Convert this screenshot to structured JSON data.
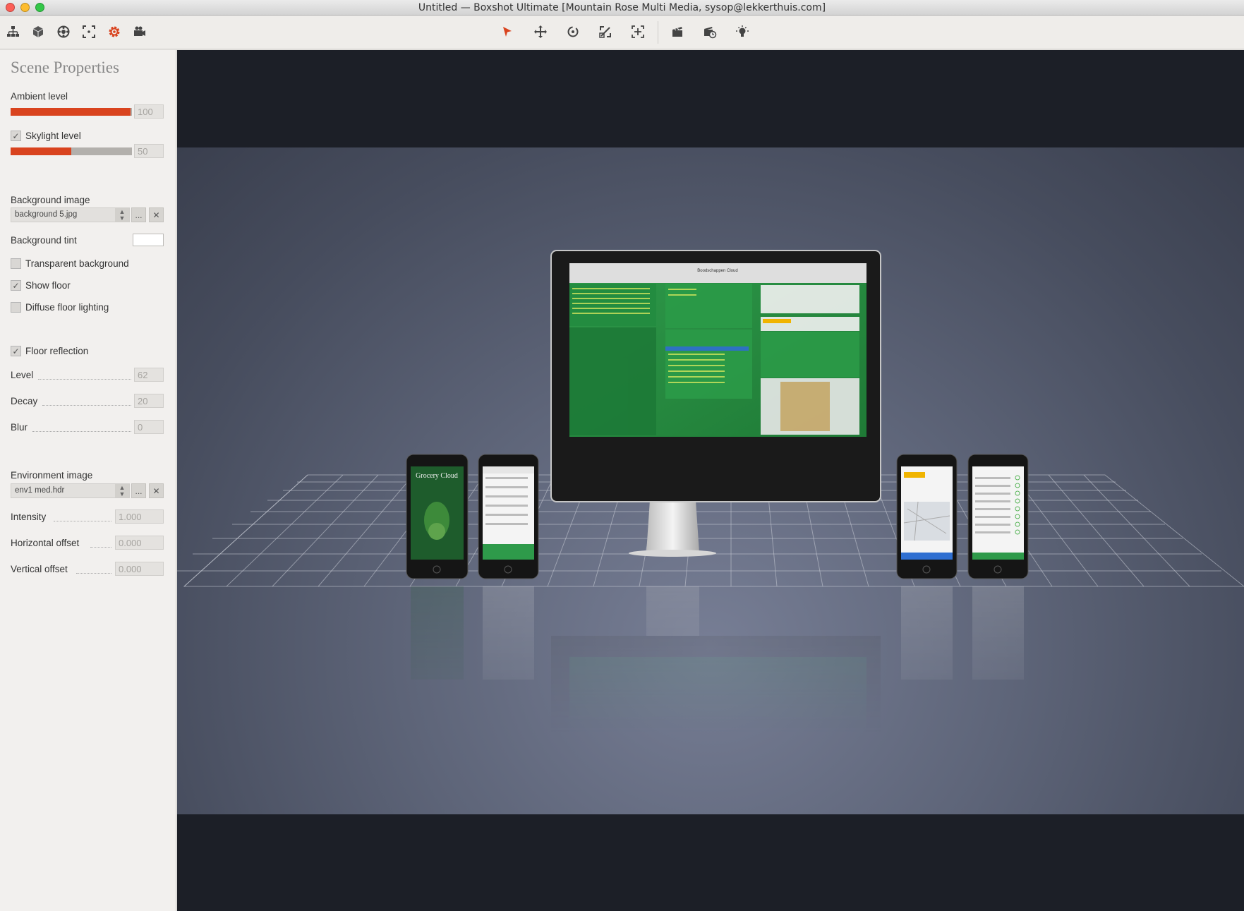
{
  "window": {
    "title": "Untitled — Boxshot Ultimate [Mountain Rose Multi Media, sysop@lekkerthuis.com]"
  },
  "toolbar": {
    "left_icons": [
      "scene-tree-icon",
      "cube-icon",
      "materials-icon",
      "camera-frame-icon",
      "settings-gear-icon",
      "video-camera-icon"
    ],
    "center_icons": [
      "select-arrow-icon",
      "move-icon",
      "rotate-icon",
      "scale-icon",
      "frame-fit-icon",
      "clapper-icon",
      "render-time-icon",
      "light-bulb-icon"
    ],
    "active": "settings-gear-icon",
    "accent_color": "#d9431e"
  },
  "panel": {
    "title": "Scene Properties",
    "ambient": {
      "label": "Ambient level",
      "value": "100",
      "level": 1.0
    },
    "skylight": {
      "label": "Skylight level",
      "checked": true,
      "value": "50",
      "level": 0.5
    },
    "background_image": {
      "label": "Background image",
      "value": "background 5.jpg",
      "browse": "...",
      "clear": "✕"
    },
    "background_tint": {
      "label": "Background tint",
      "color": "#ffffff"
    },
    "transparent_background": {
      "label": "Transparent background",
      "checked": false
    },
    "show_floor": {
      "label": "Show floor",
      "checked": true
    },
    "diffuse_floor_lighting": {
      "label": "Diffuse floor lighting",
      "checked": false
    },
    "floor_reflection": {
      "label": "Floor reflection",
      "checked": true
    },
    "level": {
      "label": "Level",
      "value": "62"
    },
    "decay": {
      "label": "Decay",
      "value": "20"
    },
    "blur": {
      "label": "Blur",
      "value": "0"
    },
    "environment_image": {
      "label": "Environment image",
      "value": "env1 med.hdr",
      "browse": "...",
      "clear": "✕"
    },
    "intensity": {
      "label": "Intensity",
      "value": "1.000"
    },
    "horizontal_offset": {
      "label": "Horizontal offset",
      "value": "0.000"
    },
    "vertical_offset": {
      "label": "Vertical offset",
      "value": "0.000"
    }
  },
  "scene": {
    "monitor_app_title": "Boodschappen Cloud",
    "phone_app_title": "Grocery Cloud"
  }
}
